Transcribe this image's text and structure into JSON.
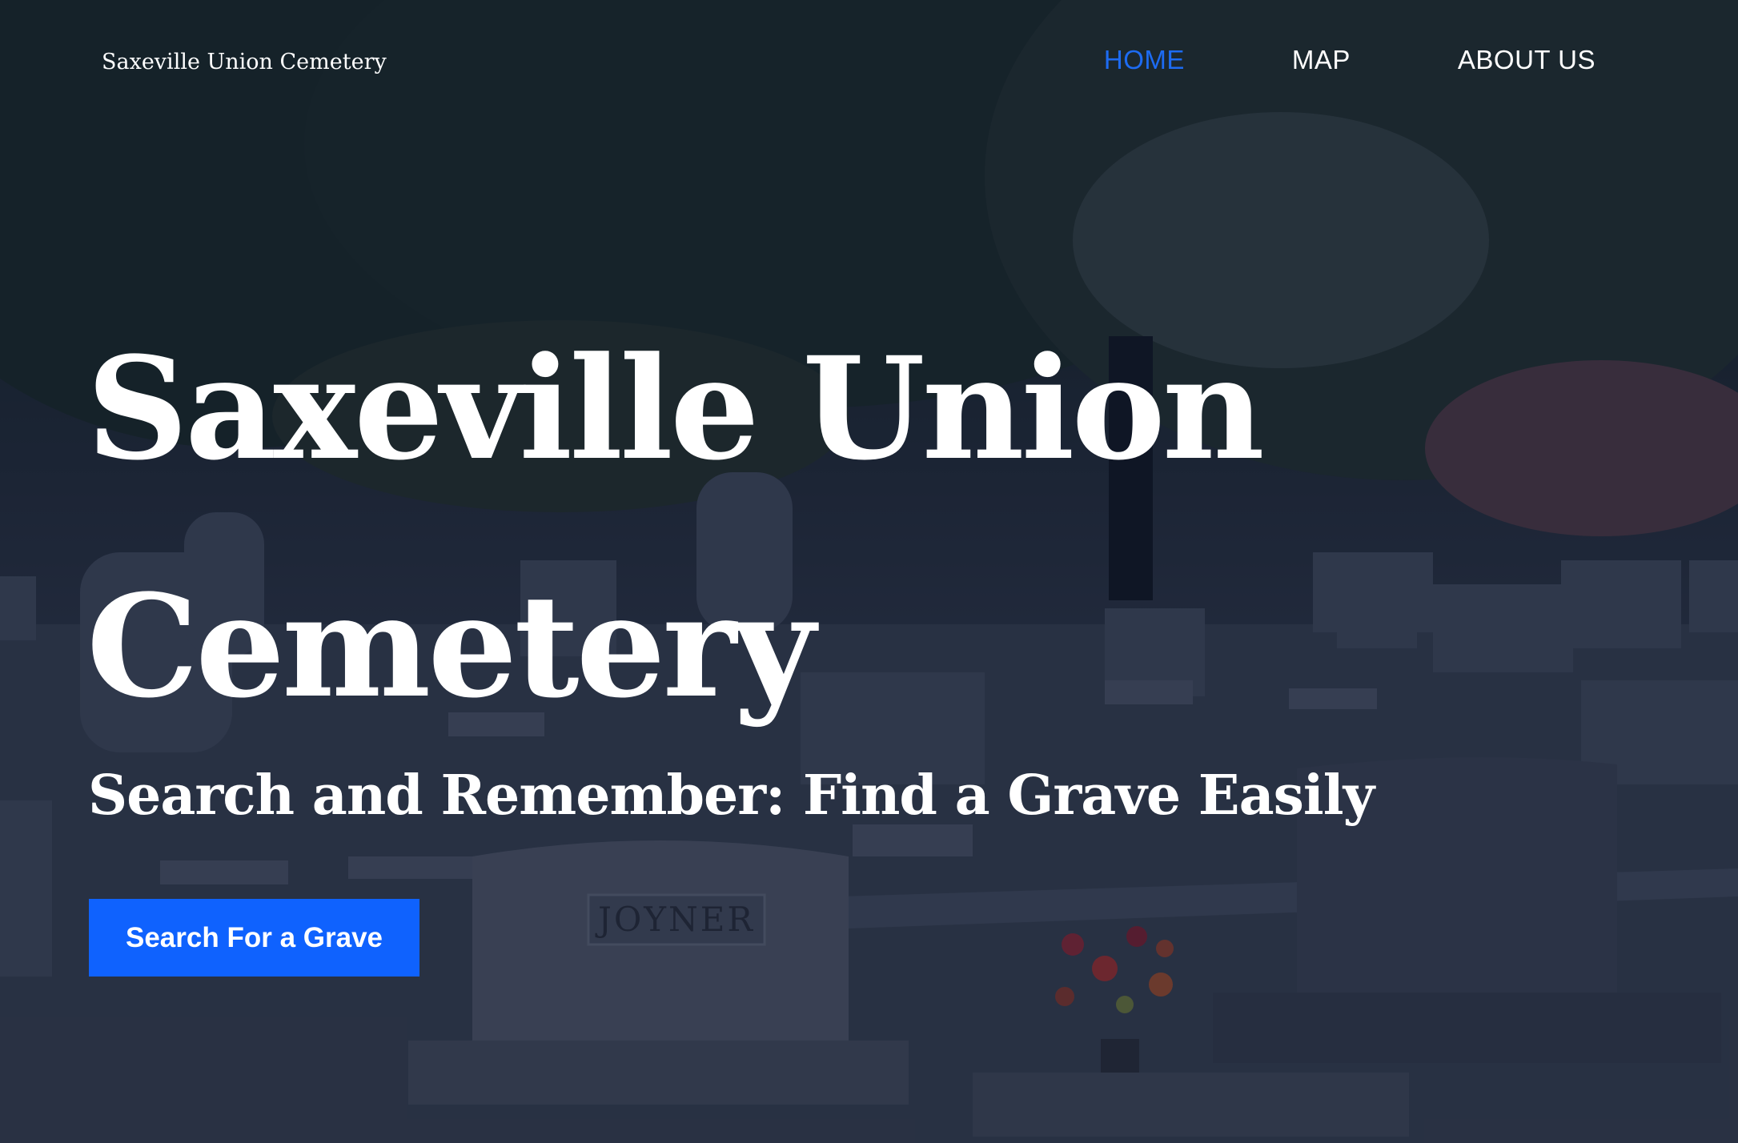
{
  "header": {
    "brand": "Saxeville Union Cemetery",
    "nav": [
      {
        "label": "HOME",
        "active": true
      },
      {
        "label": "MAP",
        "active": false
      },
      {
        "label": "ABOUT US",
        "active": false
      }
    ]
  },
  "hero": {
    "title": "Saxeville Union Cemetery",
    "subtitle": "Search and Remember: Find a Grave Easily",
    "cta_label": "Search For a Grave",
    "headstone_inscription": "JOYNER"
  },
  "colors": {
    "accent": "#0f62fe",
    "nav_active": "#1d6bf2",
    "text": "#ffffff",
    "overlay": "#101830"
  }
}
